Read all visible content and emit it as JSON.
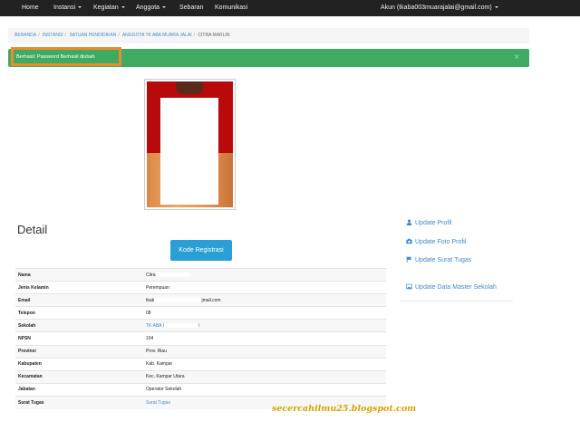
{
  "navbar": {
    "items": [
      "Home",
      "Instansi",
      "Kegiatan",
      "Anggota",
      "Sebaran",
      "Komunikasi"
    ],
    "account": "Akun (tkaba003muarajalai@gmail.com)"
  },
  "breadcrumb": {
    "links": [
      "BERANDA",
      "INSTANSI",
      "SATUAN PENDIDIKAN",
      "ANGGOTA TK ABA MUARA JALAI"
    ],
    "active": "CITRA MARLIN"
  },
  "alert": {
    "message": "Berhasil: Password Berhasil diubah",
    "close": "×"
  },
  "detail": {
    "title": "Detail",
    "kode_button": "Kode Registrasi",
    "rows": [
      {
        "label": "Nama",
        "value": "Citra"
      },
      {
        "label": "Jenis Kelamin",
        "value": "Perempuan"
      },
      {
        "label": "Email",
        "value": "tkab",
        "value2": "jmail.com"
      },
      {
        "label": "Telepon",
        "value": "08"
      },
      {
        "label": "Sekolah",
        "value": "TK ABA I",
        "value2": "I"
      },
      {
        "label": "NPSN",
        "value": "104"
      },
      {
        "label": "Provinsi",
        "value": "Prov. Riau"
      },
      {
        "label": "Kabupaten",
        "value": "Kab. Kampar"
      },
      {
        "label": "Kecamatan",
        "value": "Kec. Kampar Utara"
      },
      {
        "label": "Jabatan",
        "value": "Operator Sekolah"
      },
      {
        "label": "Surat Tugas",
        "value": "Surat Tugas"
      }
    ]
  },
  "sidebar": {
    "links": [
      "Update Profil",
      "Update Foto Profil",
      "Update Surat Tugas",
      "Update Data Master Sekolah"
    ]
  },
  "watermark": "secercahilmu25.blogspot.com",
  "colors": {
    "navbar": "#222222",
    "alert": "#3fab62",
    "highlight": "#ed8a2e",
    "button": "#2a9fd6",
    "link": "#428bca"
  }
}
